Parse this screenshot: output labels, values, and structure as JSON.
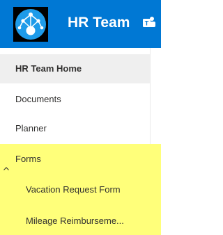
{
  "header": {
    "site_title": "HR Team",
    "logo_icon": "network-nodes-logo",
    "teams_icon": "teams-icon",
    "bg_color": "#0078d4"
  },
  "nav": {
    "items": [
      {
        "label": "HR Team Home",
        "selected": true
      },
      {
        "label": "Documents"
      },
      {
        "label": "Planner"
      }
    ],
    "forms": {
      "label": "Forms",
      "expanded": true,
      "children": [
        {
          "label": "Vacation Request Form"
        },
        {
          "label": "Mileage Reimburseme..."
        }
      ]
    },
    "highlight_color": "#ffff7a"
  }
}
